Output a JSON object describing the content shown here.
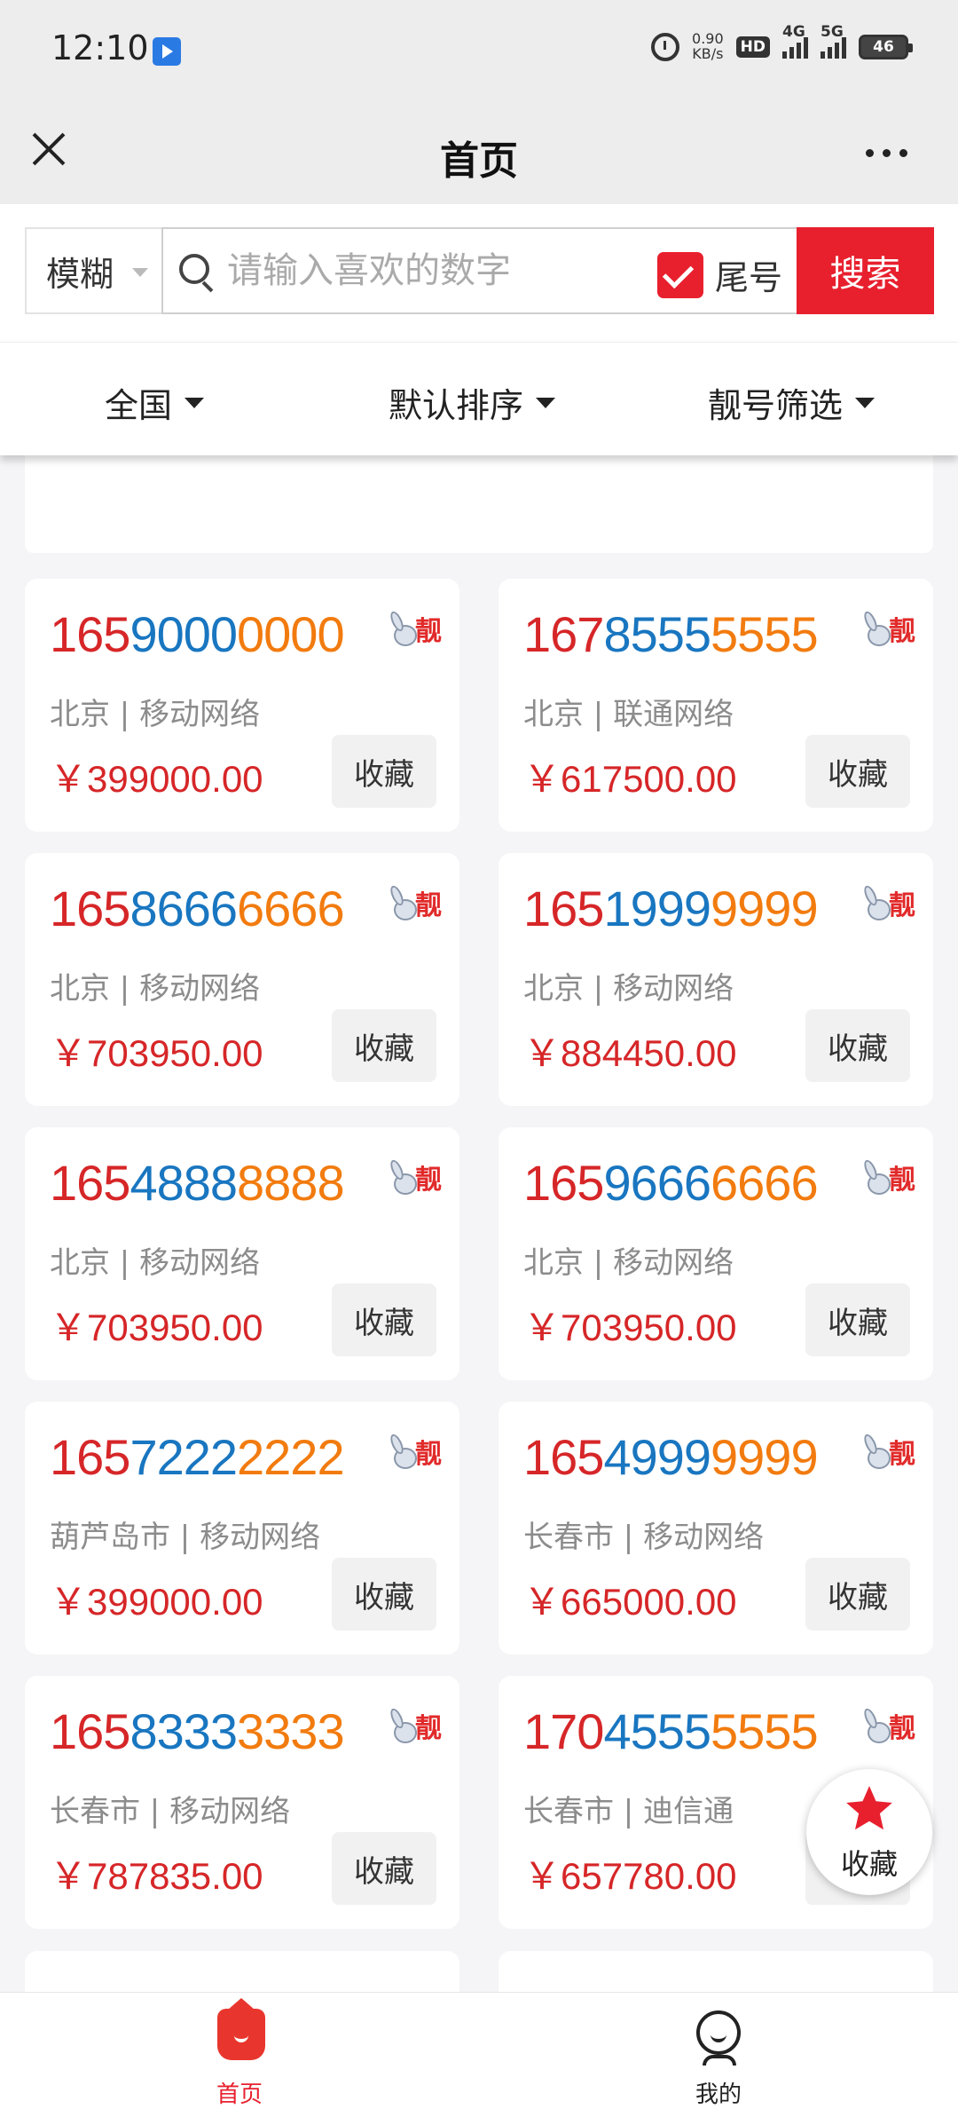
{
  "status_bar": {
    "time": "12:10",
    "net_speed_value": "0.90",
    "net_speed_unit": "KB/s",
    "hd_label": "HD",
    "network_1": "4G",
    "network_2": "5G",
    "battery": "46"
  },
  "header": {
    "title": "首页"
  },
  "search": {
    "mode_label": "模糊",
    "placeholder": "请输入喜欢的数字",
    "tail_label": "尾号",
    "tail_checked": true,
    "button_label": "搜索"
  },
  "filters": [
    {
      "label": "全国"
    },
    {
      "label": "默认排序"
    },
    {
      "label": "靓号筛选"
    }
  ],
  "badge_label": "靓",
  "fav_label": "收藏",
  "numbers": [
    {
      "a": "165",
      "b": "9000",
      "c": "0000",
      "region": "北京 | 移动网络",
      "price": "￥399000.00"
    },
    {
      "a": "167",
      "b": "8555",
      "c": "5555",
      "region": "北京 | 联通网络",
      "price": "￥617500.00"
    },
    {
      "a": "165",
      "b": "8666",
      "c": "6666",
      "region": "北京 | 移动网络",
      "price": "￥703950.00"
    },
    {
      "a": "165",
      "b": "1999",
      "c": "9999",
      "region": "北京 | 移动网络",
      "price": "￥884450.00"
    },
    {
      "a": "165",
      "b": "4888",
      "c": "8888",
      "region": "北京 | 移动网络",
      "price": "￥703950.00"
    },
    {
      "a": "165",
      "b": "9666",
      "c": "6666",
      "region": "北京 | 移动网络",
      "price": "￥703950.00"
    },
    {
      "a": "165",
      "b": "7222",
      "c": "2222",
      "region": "葫芦岛市 | 移动网络",
      "price": "￥399000.00"
    },
    {
      "a": "165",
      "b": "4999",
      "c": "9999",
      "region": "长春市 | 移动网络",
      "price": "￥665000.00"
    },
    {
      "a": "165",
      "b": "8333",
      "c": "3333",
      "region": "长春市 | 移动网络",
      "price": "￥787835.00"
    },
    {
      "a": "170",
      "b": "4555",
      "c": "5555",
      "region": "长春市 | 迪信通",
      "price": "￥657780.00"
    }
  ],
  "float_fav": {
    "label": "收藏",
    "icon": "star-icon"
  },
  "tab_bar": {
    "items": [
      {
        "label": "首页",
        "icon": "home-icon",
        "active": true
      },
      {
        "label": "我的",
        "icon": "user-icon",
        "active": false
      }
    ]
  },
  "colors": {
    "accent": "#e8202e",
    "prefix": "#d62628",
    "middle": "#1976c0",
    "suffix": "#f27b0f",
    "price": "#d62628"
  }
}
